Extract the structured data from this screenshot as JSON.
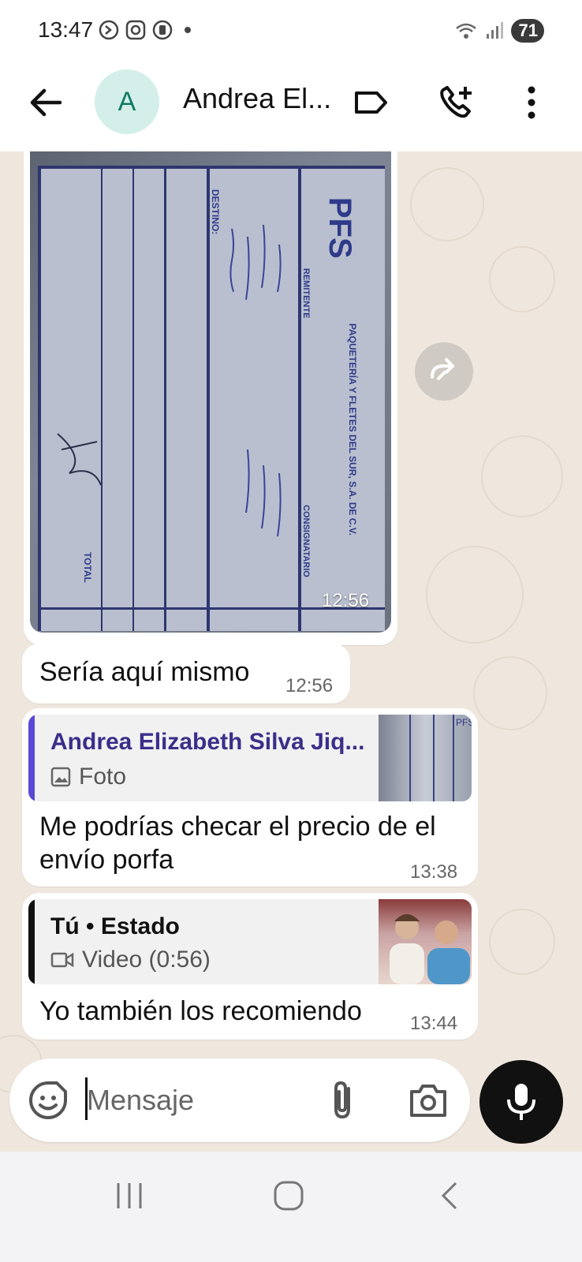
{
  "status_bar": {
    "time": "13:47",
    "battery": "71"
  },
  "header": {
    "avatar_letter": "A",
    "contact_name": "Andrea El..."
  },
  "messages": [
    {
      "type": "image",
      "time": "12:56"
    },
    {
      "type": "text",
      "text": "Sería aquí mismo",
      "time": "12:56"
    },
    {
      "type": "reply",
      "quoted_name": "Andrea Elizabeth Silva Jiq...",
      "quoted_kind": "Foto",
      "text_line1": "Me podrías checar el precio de el",
      "text_line2": "envío porfa",
      "time": "13:38"
    },
    {
      "type": "reply",
      "quoted_name": "Tú • Estado",
      "quoted_kind": "Video (0:56)",
      "text": "Yo también los recomiendo",
      "time": "13:44"
    }
  ],
  "document_labels": {
    "brand": "PFS",
    "company": "PAQUETERÍA Y FLETES DEL SUR, S.A. DE C.V.",
    "remitente": "REMITENTE",
    "consignatario": "CONSIGNATARIO",
    "destino": "DESTINO:",
    "total": "TOTAL"
  },
  "composer": {
    "placeholder": "Mensaje"
  },
  "colors": {
    "reply_bar_purple": "#5a48d6",
    "quote_name_purple": "#3b2e8a",
    "chat_background": "#efe7de"
  }
}
